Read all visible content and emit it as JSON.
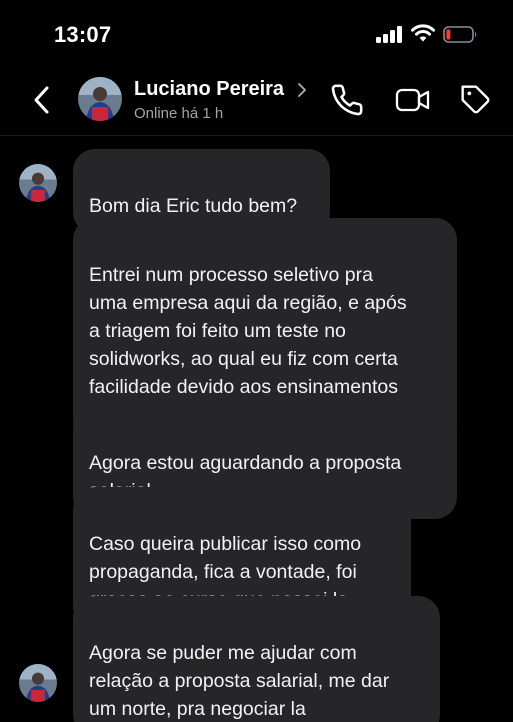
{
  "status_bar": {
    "time": "13:07",
    "icons": [
      "signal-icon",
      "wifi-icon",
      "battery-low-icon"
    ],
    "battery_color": "#ff3b30"
  },
  "header": {
    "back_icon": "chevron-left-icon",
    "contact_name": "Luciano Pereira",
    "contact_status": "Online há 1 h",
    "actions": [
      "phone-icon",
      "video-camera-icon",
      "tag-icon"
    ]
  },
  "messages": [
    {
      "text": "Bom dia Eric tudo bem?"
    },
    {
      "text": "Entrei num processo seletivo pra\numa empresa aqui da região, e após\na triagem foi feito um teste no\nsolidworks, ao qual eu fiz com certa\nfacilidade devido aos ensinamentos\ndo curso, e passei no teste!"
    },
    {
      "text": "Agora estou aguardando a proposta\nsalarial."
    },
    {
      "text": "Caso queira publicar isso como\npropaganda, fica a vontade, foi\ngracas ao curso que passei la"
    },
    {
      "text": "Agora se puder me ajudar com\nrelação a proposta salarial, me dar\num norte, pra negociar la"
    }
  ],
  "colors": {
    "background": "#000000",
    "bubble": "#262629",
    "secondary_text": "#a3a3a8"
  }
}
